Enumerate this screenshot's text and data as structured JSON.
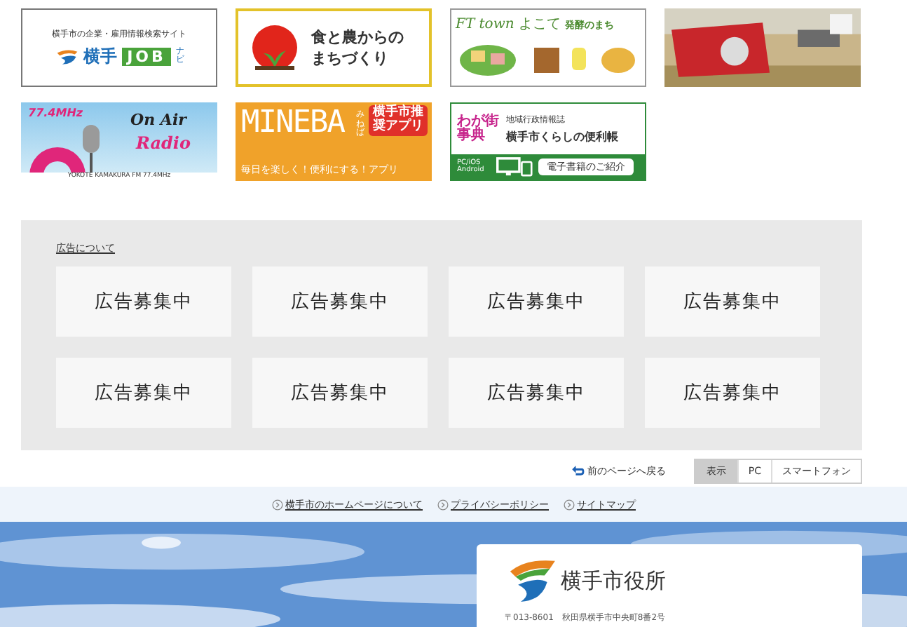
{
  "banners": [
    {
      "kind": "job",
      "lines": [
        "横手市の企業・雇用情報検索サイト",
        "横手",
        "JOB",
        "ナビ"
      ]
    },
    {
      "kind": "food",
      "lines": [
        "食と農からの",
        "まちづくり"
      ]
    },
    {
      "kind": "ferment",
      "lines": [
        "FT town",
        "よこて",
        "発酵のまち"
      ]
    },
    {
      "kind": "picture"
    },
    {
      "kind": "radio",
      "lines": [
        "77.4MHz",
        "On Air",
        "Radio",
        "YOKOTE KAMAKURA FM 77.4MHz"
      ]
    },
    {
      "kind": "mineba",
      "lines": [
        "MINEBA",
        "みねば",
        "横手市推奨アプリ",
        "毎日を楽しく！便利にする！アプリ"
      ]
    },
    {
      "kind": "book",
      "lines": [
        "わが街事典",
        "地域行政情報誌",
        "横手市くらしの便利帳",
        "PC/iOS Android",
        "電子書籍のご紹介"
      ]
    }
  ],
  "ads": {
    "link": "広告について",
    "slots": [
      "広告募集中",
      "広告募集中",
      "広告募集中",
      "広告募集中",
      "広告募集中",
      "広告募集中",
      "広告募集中",
      "広告募集中"
    ]
  },
  "back_link": "前のページへ戻る",
  "display_switch": {
    "label": "表示",
    "options": [
      "PC",
      "スマートフォン"
    ]
  },
  "footer_links": [
    "横手市のホームページについて",
    "プライバシーポリシー",
    "サイトマップ"
  ],
  "office": {
    "name": "横手市役所",
    "address": "〒013-8601　秋田県横手市中央町8番2号"
  }
}
